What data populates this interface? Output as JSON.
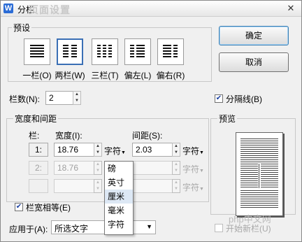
{
  "window": {
    "title": "分栏",
    "app_icon": "W",
    "close": "✕",
    "ghost_title": "页面设置"
  },
  "presets": {
    "group_label": "预设",
    "items": [
      {
        "label": "一栏(O)",
        "icon": "one-column-icon"
      },
      {
        "label": "两栏(W)",
        "icon": "two-column-icon"
      },
      {
        "label": "三栏(T)",
        "icon": "three-column-icon"
      },
      {
        "label": "偏左(L)",
        "icon": "left-column-icon"
      },
      {
        "label": "偏右(R)",
        "icon": "right-column-icon"
      }
    ],
    "selected": "两栏(W)"
  },
  "buttons": {
    "ok": "确定",
    "cancel": "取消"
  },
  "columns": {
    "label": "栏数(N):",
    "value": "2"
  },
  "separator": {
    "label": "分隔线(B)",
    "checked": true
  },
  "width_spacing": {
    "group_label": "宽度和间距",
    "col_header": "栏:",
    "width_header": "宽度(I):",
    "spacing_header": "间距(S):",
    "rows": [
      {
        "col": "1:",
        "width": "18.76",
        "width_unit": "字符",
        "spacing": "2.03",
        "spacing_unit": "字符"
      },
      {
        "col": "2:",
        "width": "18.76",
        "width_unit": "字符",
        "spacing": "",
        "spacing_unit": "字符"
      },
      {
        "col": "",
        "width": "",
        "width_unit": "",
        "spacing": "",
        "spacing_unit": "字符"
      }
    ]
  },
  "unit_dropdown": {
    "options": [
      "磅",
      "英寸",
      "厘米",
      "毫米",
      "字符"
    ],
    "highlighted": "厘米"
  },
  "equal_width": {
    "label": "栏宽相等(E)",
    "checked": true
  },
  "preview": {
    "label": "预览"
  },
  "apply_to": {
    "label": "应用于(A):",
    "value": "所选文字"
  },
  "new_column": {
    "label": "开始新栏(U)",
    "checked": false
  },
  "watermark": "php中文网",
  "colors": {
    "accent": "#3a6fb5",
    "highlight": "#dde8f5",
    "disabled": "#a0a0a0"
  }
}
